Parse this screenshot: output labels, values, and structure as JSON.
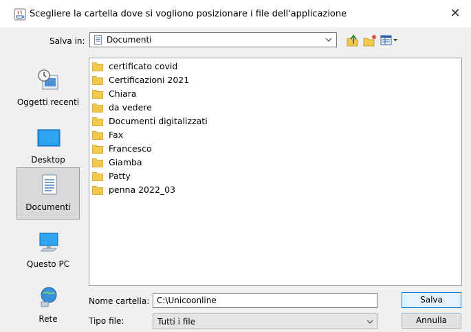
{
  "window": {
    "title": "Scegliere la cartella dove si vogliono posizionare i file dell'applicazione",
    "close_glyph": "✕"
  },
  "toolbar": {
    "save_in_label": "Salva in:",
    "save_in_value": "Documenti",
    "up_icon": "up-folder-icon",
    "new_folder_icon": "new-folder-icon",
    "view_icon": "details-view-icon"
  },
  "places": [
    {
      "label": "Oggetti recenti",
      "icon": "recent-items-icon"
    },
    {
      "label": "Desktop",
      "icon": "desktop-icon"
    },
    {
      "label": "Documenti",
      "icon": "documents-icon",
      "selected": true
    },
    {
      "label": "Questo PC",
      "icon": "computer-icon"
    },
    {
      "label": "Rete",
      "icon": "network-icon"
    }
  ],
  "files": [
    "certificato covid",
    "Certificazioni 2021",
    "Chiara",
    "da vedere",
    "Documenti digitalizzati",
    "Fax",
    "Francesco",
    "Giamba",
    "Patty",
    "penna 2022_03"
  ],
  "form": {
    "name_label": "Nome cartella:",
    "name_value": "C:\\Unicoonline",
    "type_label": "Tipo file:",
    "type_value": "Tutti i file"
  },
  "buttons": {
    "save": "Salva",
    "cancel": "Annulla"
  },
  "colors": {
    "folder": "#f2c94c",
    "selection_border": "#0078d7",
    "dialog_bg": "#f0f0f0"
  }
}
